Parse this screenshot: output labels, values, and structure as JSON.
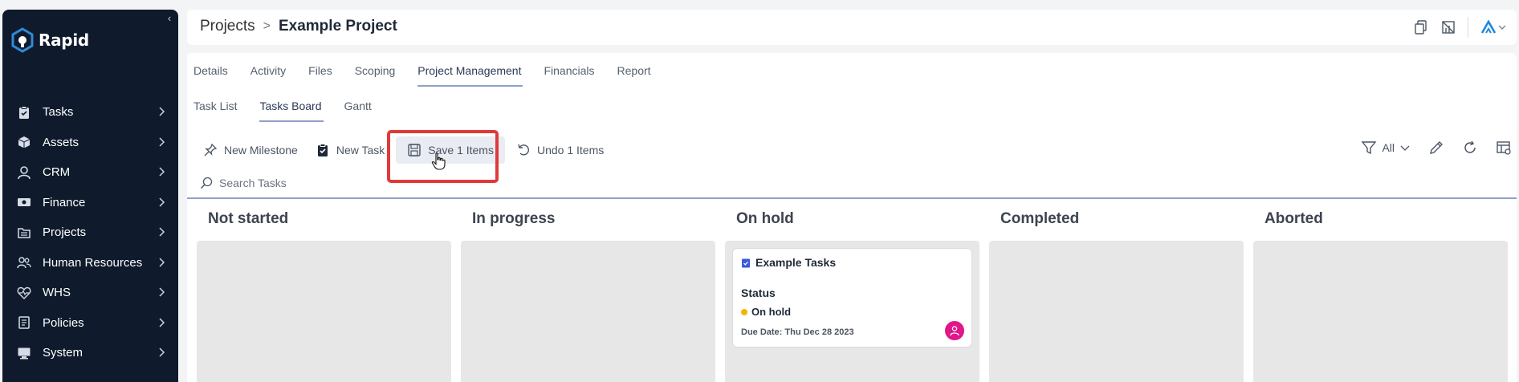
{
  "app": {
    "name": "Rapid"
  },
  "sidebar": {
    "items": [
      {
        "label": "Tasks",
        "icon": "clipboard-check-icon"
      },
      {
        "label": "Assets",
        "icon": "box-icon"
      },
      {
        "label": "CRM",
        "icon": "user-icon"
      },
      {
        "label": "Finance",
        "icon": "money-icon"
      },
      {
        "label": "Projects",
        "icon": "folder-icon"
      },
      {
        "label": "Human Resources",
        "icon": "people-icon"
      },
      {
        "label": "WHS",
        "icon": "heart-pulse-icon"
      },
      {
        "label": "Policies",
        "icon": "document-icon"
      },
      {
        "label": "System",
        "icon": "monitor-icon"
      }
    ]
  },
  "header": {
    "breadcrumb_root": "Projects",
    "breadcrumb_sep": ">",
    "breadcrumb_current": "Example Project"
  },
  "tabs": [
    "Details",
    "Activity",
    "Files",
    "Scoping",
    "Project Management",
    "Financials",
    "Report"
  ],
  "active_tab": "Project Management",
  "subtabs": [
    "Task List",
    "Tasks Board",
    "Gantt"
  ],
  "active_subtab": "Tasks Board",
  "toolbar": {
    "new_milestone": "New Milestone",
    "new_task": "New Task",
    "save": "Save 1 Items",
    "undo": "Undo 1 Items",
    "filter": "All"
  },
  "search": {
    "placeholder": "Search Tasks"
  },
  "board": {
    "columns": [
      "Not started",
      "In progress",
      "On hold",
      "Completed",
      "Aborted"
    ],
    "card": {
      "title": "Example Tasks",
      "status_label": "Status",
      "status_value": "On hold",
      "status_color": "#f2b600",
      "due": "Due Date: Thu Dec 28 2023",
      "avatar_color": "#e0168a"
    }
  },
  "colors": {
    "sidebar": "#0f1b2d",
    "accent": "#8ea0c8",
    "highlight": "#e03a3a"
  }
}
